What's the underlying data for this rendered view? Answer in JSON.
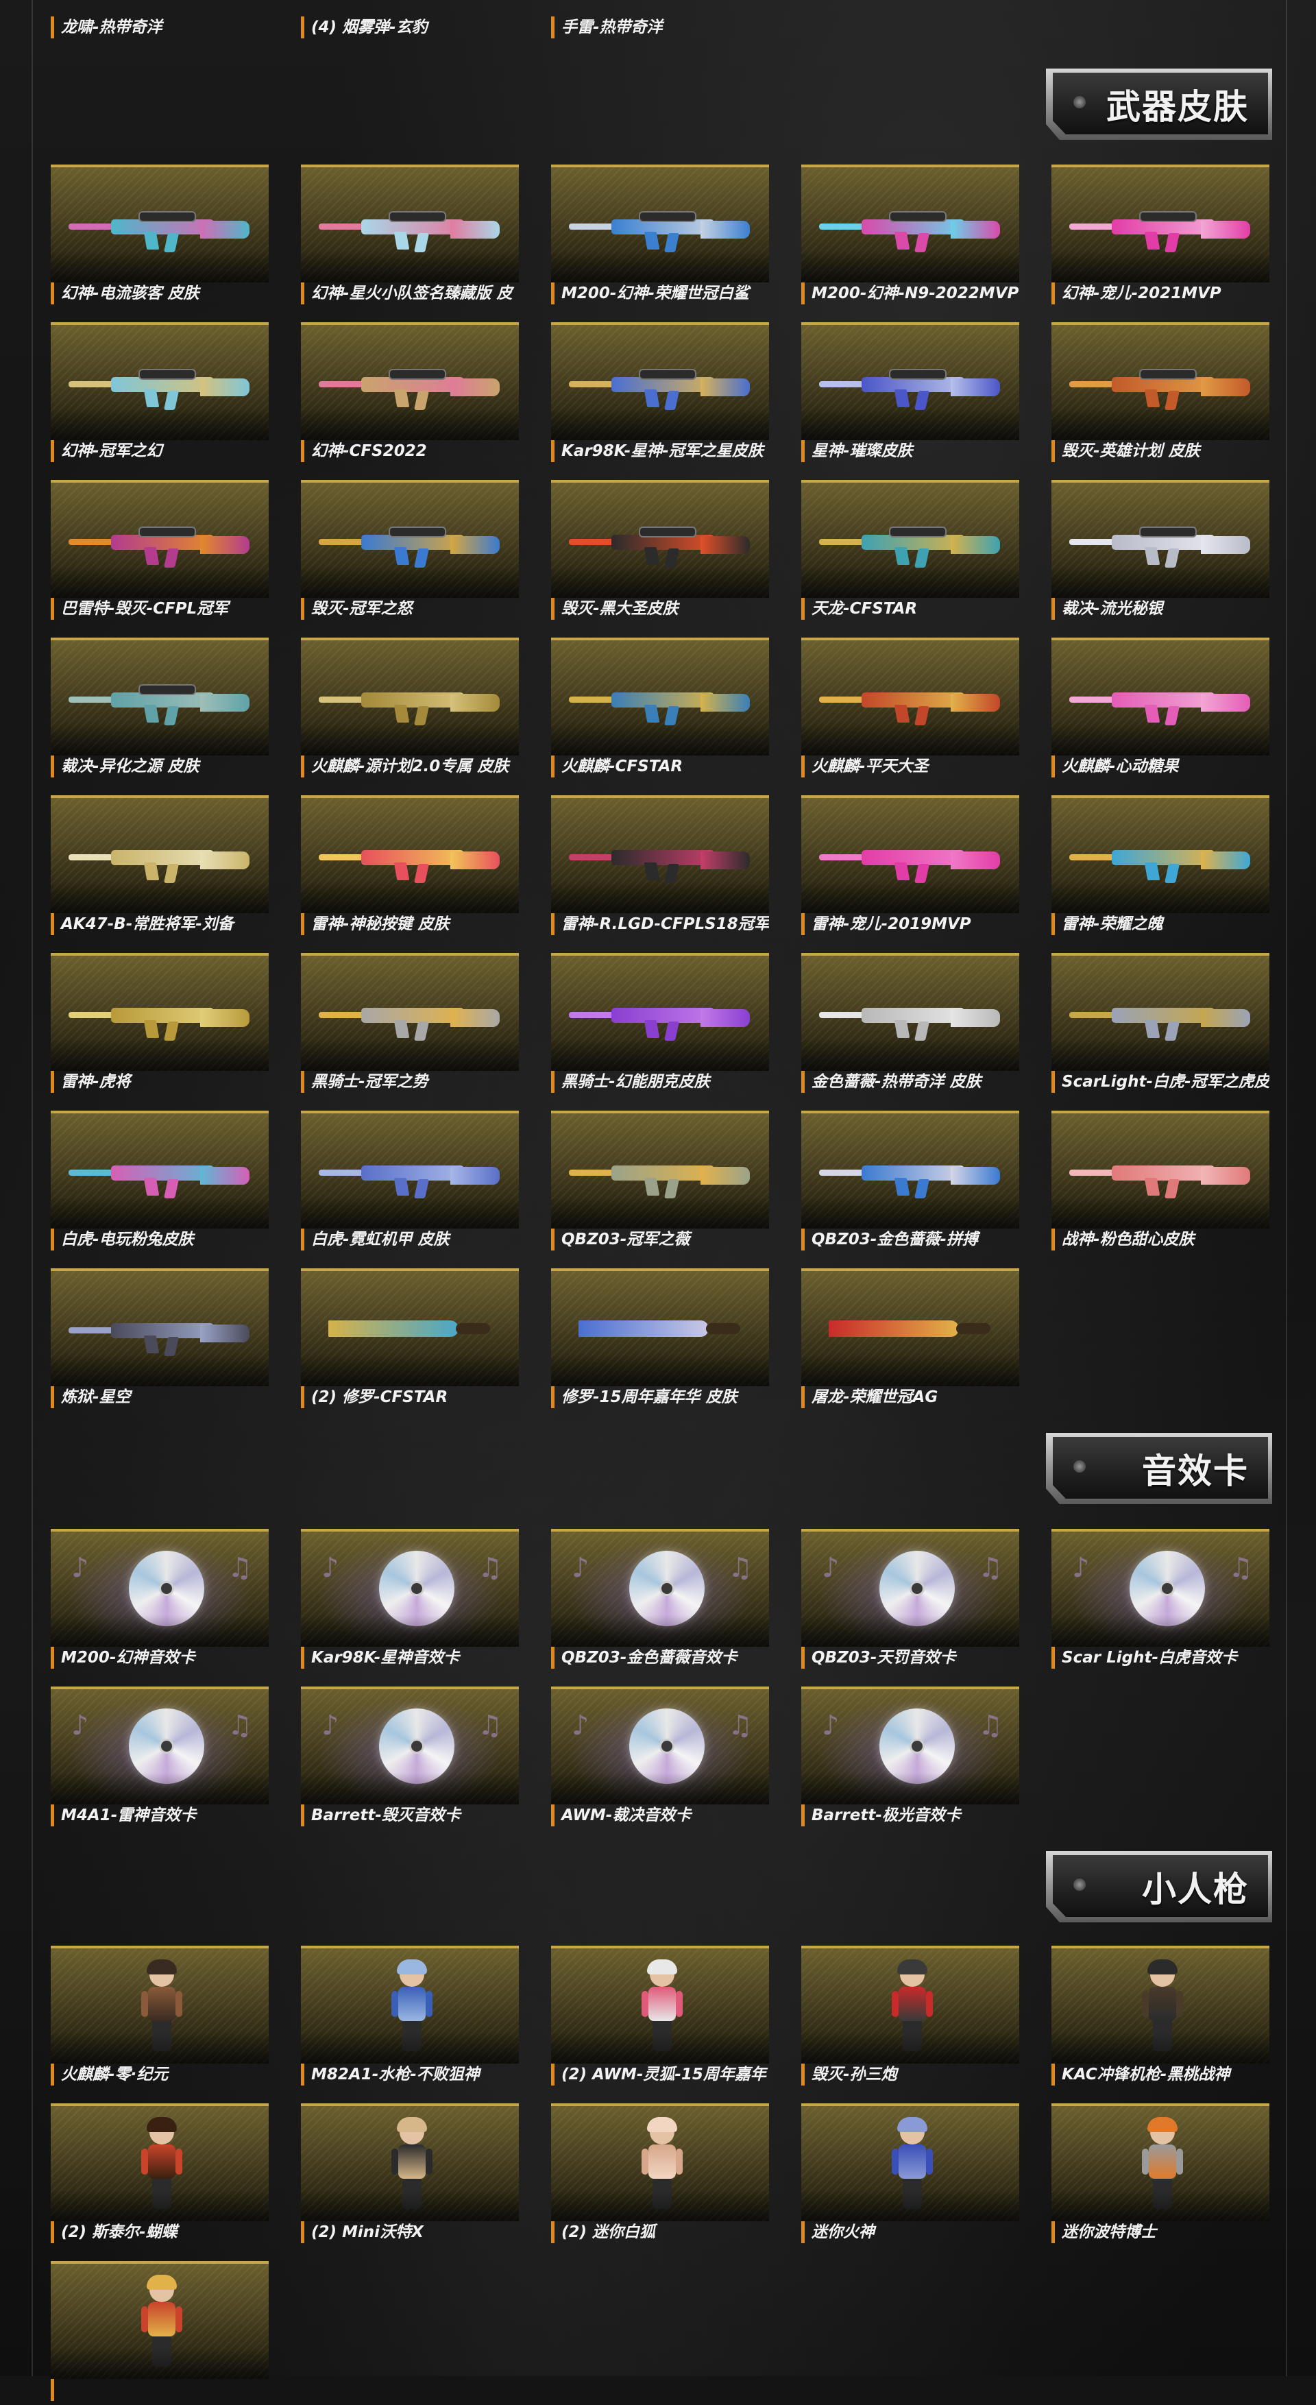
{
  "top_row": [
    {
      "label": "龙啸-热带奇洋"
    },
    {
      "label": "(4) 烟雾弹-玄豹"
    },
    {
      "label": "手雷-热带奇洋"
    }
  ],
  "sections": {
    "weapon_skins": {
      "title": "武器皮肤",
      "items": [
        {
          "label": "幻神-电流骇客 皮肤",
          "kind": "sniper",
          "c1": "#4fb7c9",
          "c2": "#d26db5"
        },
        {
          "label": "幻神-星火小队签名臻藏版 皮",
          "kind": "sniper",
          "c1": "#a9d7e7",
          "c2": "#e27a9e"
        },
        {
          "label": "M200-幻神-荣耀世冠白鲨",
          "kind": "sniper",
          "c1": "#3b7fd1",
          "c2": "#c7d3e2"
        },
        {
          "label": "M200-幻神-N9-2022MVP",
          "kind": "sniper",
          "c1": "#d94aa9",
          "c2": "#6bd1ea"
        },
        {
          "label": "幻神-宠儿-2021MVP",
          "kind": "sniper",
          "c1": "#e23da6",
          "c2": "#f2a7d5"
        },
        {
          "label": "幻神-冠军之幻",
          "kind": "sniper",
          "c1": "#7fc6d8",
          "c2": "#d7c27b"
        },
        {
          "label": "幻神-CFS2022",
          "kind": "sniper",
          "c1": "#c9a46d",
          "c2": "#e07a9a"
        },
        {
          "label": "Kar98K-星神-冠军之星皮肤",
          "kind": "sniper",
          "c1": "#4a6fd1",
          "c2": "#d6b25a"
        },
        {
          "label": "星神-璀璨皮肤",
          "kind": "sniper",
          "c1": "#4b56c9",
          "c2": "#b7c1ea"
        },
        {
          "label": "毁灭-英雄计划 皮肤",
          "kind": "sniper",
          "c1": "#c25a2a",
          "c2": "#e29b46"
        },
        {
          "label": "巴雷特-毁灭-CFPL冠军",
          "kind": "sniper",
          "c1": "#b33c8f",
          "c2": "#e38a2a"
        },
        {
          "label": "毁灭-冠军之怒",
          "kind": "sniper",
          "c1": "#3b7ad1",
          "c2": "#d7a73e"
        },
        {
          "label": "毁灭-黑大圣皮肤",
          "kind": "sniper",
          "c1": "#2b2b2b",
          "c2": "#e2502a"
        },
        {
          "label": "天龙-CFSTAR",
          "kind": "sniper",
          "c1": "#3ea2b2",
          "c2": "#d6b24a"
        },
        {
          "label": "裁决-流光秘银",
          "kind": "sniper",
          "c1": "#b8bcc8",
          "c2": "#e6e6ef"
        },
        {
          "label": "裁决-异化之源 皮肤",
          "kind": "sniper",
          "c1": "#5fa2a7",
          "c2": "#9fbfb9"
        },
        {
          "label": "火麒麟-源计划2.0专属 皮肤",
          "kind": "rifle",
          "c1": "#a48a3a",
          "c2": "#d6c27a"
        },
        {
          "label": "火麒麟-CFSTAR",
          "kind": "rifle",
          "c1": "#3a7fb8",
          "c2": "#d6b24a"
        },
        {
          "label": "火麒麟-平天大圣",
          "kind": "rifle",
          "c1": "#c2472a",
          "c2": "#e2b24a"
        },
        {
          "label": "火麒麟-心动糖果",
          "kind": "rifle",
          "c1": "#e45db7",
          "c2": "#f2a7d5"
        },
        {
          "label": "AK47-B-常胜将军-刘备",
          "kind": "rifle",
          "c1": "#c9b46a",
          "c2": "#e8e0b7"
        },
        {
          "label": "雷神-神秘按键 皮肤",
          "kind": "rifle",
          "c1": "#e7505c",
          "c2": "#f2c65a"
        },
        {
          "label": "雷神-R.LGD-CFPLS18冠军",
          "kind": "rifle",
          "c1": "#2b2b2b",
          "c2": "#c53f6b"
        },
        {
          "label": "雷神-宠儿-2019MVP",
          "kind": "rifle",
          "c1": "#e23da6",
          "c2": "#f07ac8"
        },
        {
          "label": "雷神-荣耀之魄",
          "kind": "rifle",
          "c1": "#3ea7d6",
          "c2": "#e2b24a"
        },
        {
          "label": "雷神-虎将",
          "kind": "rifle",
          "c1": "#b89a3a",
          "c2": "#e2cf7a"
        },
        {
          "label": "黑骑士-冠军之势",
          "kind": "rifle",
          "c1": "#a8a8a8",
          "c2": "#e2b24a"
        },
        {
          "label": "黑骑士-幻能朋克皮肤",
          "kind": "rifle",
          "c1": "#8a3fd1",
          "c2": "#c27ae8"
        },
        {
          "label": "金色蔷薇-热带奇洋 皮肤",
          "kind": "rifle",
          "c1": "#b8b8b8",
          "c2": "#e6e6e6"
        },
        {
          "label": "ScarLight-白虎-冠军之虎皮",
          "kind": "rifle",
          "c1": "#9aa3b7",
          "c2": "#c7a74a"
        },
        {
          "label": "白虎-电玩粉兔皮肤",
          "kind": "rifle",
          "c1": "#d65fb5",
          "c2": "#5fb8d6"
        },
        {
          "label": "白虎-霓虹机甲 皮肤",
          "kind": "rifle",
          "c1": "#5a6fc9",
          "c2": "#a7b7e8"
        },
        {
          "label": "QBZ03-冠军之薇",
          "kind": "rifle",
          "c1": "#9aa38a",
          "c2": "#e2b24a"
        },
        {
          "label": "QBZ03-金色蔷薇-拼搏",
          "kind": "rifle",
          "c1": "#3b7ad1",
          "c2": "#d6d6e6"
        },
        {
          "label": "战神-粉色甜心皮肤",
          "kind": "rifle",
          "c1": "#e07a7a",
          "c2": "#f2b7b7"
        },
        {
          "label": "炼狱-星空",
          "kind": "rifle",
          "c1": "#4a4a5a",
          "c2": "#9aa3c7"
        },
        {
          "label": "(2) 修罗-CFSTAR",
          "kind": "blade",
          "c1": "#d6b24a",
          "c2": "#4aa7c9"
        },
        {
          "label": "修罗-15周年嘉年华 皮肤",
          "kind": "blade",
          "c1": "#4a6fd1",
          "c2": "#c9c9e6"
        },
        {
          "label": "屠龙-荣耀世冠AG",
          "kind": "blade",
          "c1": "#c92a2a",
          "c2": "#e2b24a"
        }
      ]
    },
    "sound_cards": {
      "title": "音效卡",
      "items": [
        {
          "label": "M200-幻神音效卡"
        },
        {
          "label": "Kar98K-星神音效卡"
        },
        {
          "label": "QBZ03-金色蔷薇音效卡"
        },
        {
          "label": "QBZ03-天罚音效卡"
        },
        {
          "label": "Scar Light-白虎音效卡"
        },
        {
          "label": "M4A1-雷神音效卡"
        },
        {
          "label": "Barrett-毁灭音效卡"
        },
        {
          "label": "AWM-裁决音效卡"
        },
        {
          "label": "Barrett-极光音效卡"
        }
      ]
    },
    "mini_figures": {
      "title": "小人枪",
      "items": [
        {
          "label": "火麒麟-零·纪元",
          "c1": "#8a5a3a",
          "c2": "#3a2b22"
        },
        {
          "label": "M82A1-水枪-不败狙神",
          "c1": "#3a5fb7",
          "c2": "#9ab7e2"
        },
        {
          "label": "(2) AWM-灵狐-15周年嘉年",
          "c1": "#e05a7a",
          "c2": "#e8e8e8"
        },
        {
          "label": "毁灭-孙三炮",
          "c1": "#c92a2a",
          "c2": "#3a3a3a"
        },
        {
          "label": "KAC冲锋机枪-黑桃战神",
          "c1": "#4a3a2a",
          "c2": "#2b2b2b"
        },
        {
          "label": "(2) 斯泰尔-蝴蝶",
          "c1": "#c9442a",
          "c2": "#3a2010"
        },
        {
          "label": "(2) Mini沃特X",
          "c1": "#2b2b2b",
          "c2": "#d6b78a"
        },
        {
          "label": "(2) 迷你白狐",
          "c1": "#d6a78a",
          "c2": "#f2d6c2"
        },
        {
          "label": "迷你火神",
          "c1": "#3a4fb7",
          "c2": "#8a9ad6"
        },
        {
          "label": "迷你波特博士",
          "c1": "#9a9a9a",
          "c2": "#e07a2a"
        },
        {
          "label": "",
          "c1": "#c9442a",
          "c2": "#e2b24a"
        }
      ]
    }
  }
}
